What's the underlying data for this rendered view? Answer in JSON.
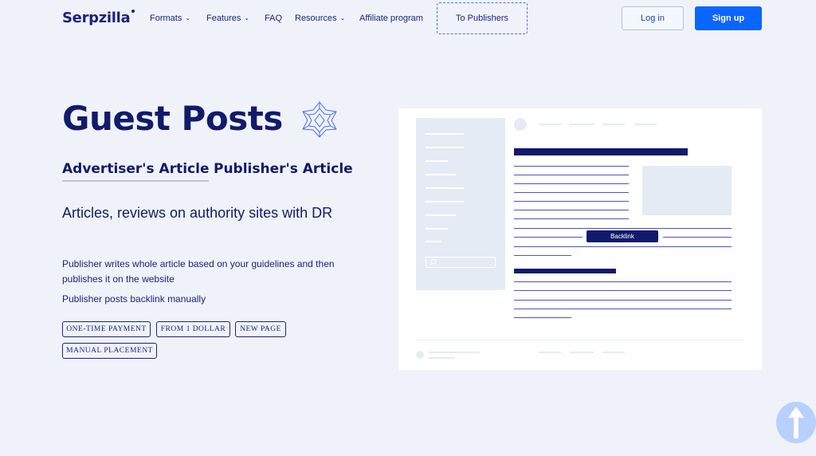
{
  "header": {
    "logo": "Serpzilla",
    "nav": [
      {
        "label": "Formats",
        "has_dropdown": true
      },
      {
        "label": "Features",
        "has_dropdown": true
      },
      {
        "label": "FAQ",
        "has_dropdown": false
      },
      {
        "label": "Resources",
        "has_dropdown": true
      },
      {
        "label": "Affiliate program",
        "has_dropdown": false
      }
    ],
    "to_publishers": "To Publishers",
    "login": "Log in",
    "signup": "Sign up"
  },
  "hero": {
    "title": "Guest Posts",
    "tabs": [
      {
        "label": "Advertiser's Article",
        "active": true
      },
      {
        "label": "Publisher's Article",
        "active": false
      }
    ],
    "subtitle": "Articles, reviews on authority sites with DR",
    "description_1": "Publisher writes whole article based on your guidelines and then publishes it on the website",
    "description_2": "Publisher posts backlink manually",
    "badges": [
      "ONE-TIME PAYMENT",
      "FROM 1 DOLLAR",
      "NEW PAGE",
      "MANUAL PLACEMENT"
    ]
  },
  "illustration": {
    "backlink_label": "Backlink"
  },
  "icons": {
    "star": "star-icon",
    "chevron": "chevron-down-icon",
    "scroll_up": "arrow-up-icon",
    "search": "search-icon"
  },
  "colors": {
    "accent": "#0a66ff",
    "navy": "#111a6b",
    "background": "#eff3f9"
  }
}
